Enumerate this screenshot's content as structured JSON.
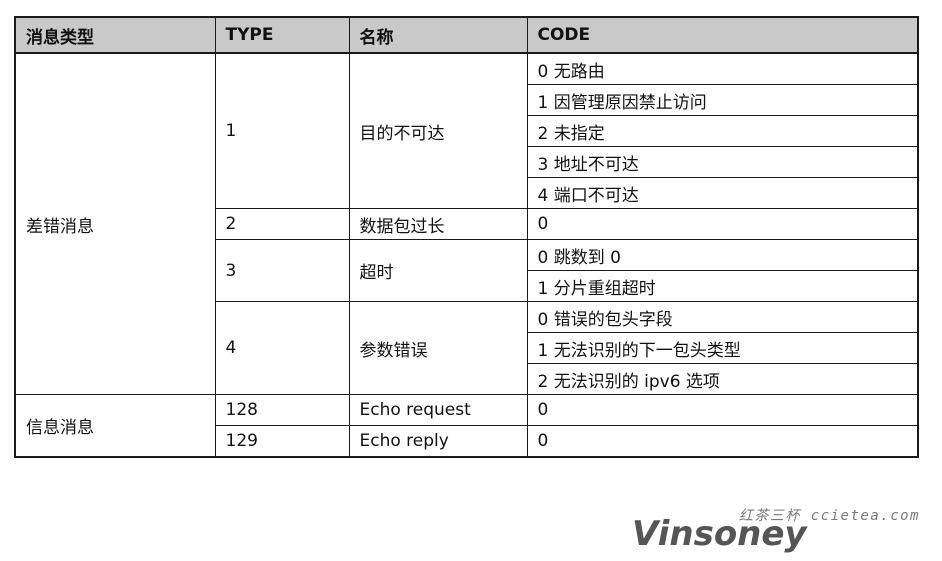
{
  "table": {
    "headers": [
      "消息类型",
      "TYPE",
      "名称",
      "CODE"
    ],
    "groups": {
      "error": {
        "label": "差错消息",
        "types": [
          {
            "type": "1",
            "name": "目的不可达",
            "codes": [
              "0 无路由",
              "1 因管理原因禁止访问",
              "2 未指定",
              "3 地址不可达",
              "4 端口不可达"
            ]
          },
          {
            "type": "2",
            "name": "数据包过长",
            "codes": [
              "0"
            ]
          },
          {
            "type": "3",
            "name": "超时",
            "codes": [
              "0 跳数到 0",
              "1 分片重组超时"
            ]
          },
          {
            "type": "4",
            "name": "参数错误",
            "codes": [
              "0 错误的包头字段",
              "1 无法识别的下一包头类型",
              "2 无法识别的 ipv6 选项"
            ]
          }
        ]
      },
      "info": {
        "label": "信息消息",
        "types": [
          {
            "type": "128",
            "name": "Echo request",
            "codes": [
              "0"
            ]
          },
          {
            "type": "129",
            "name": "Echo reply",
            "codes": [
              "0"
            ]
          }
        ]
      }
    }
  },
  "watermark": {
    "site": "红茶三杯 ccietea.com",
    "logo": "Vinsoney"
  }
}
